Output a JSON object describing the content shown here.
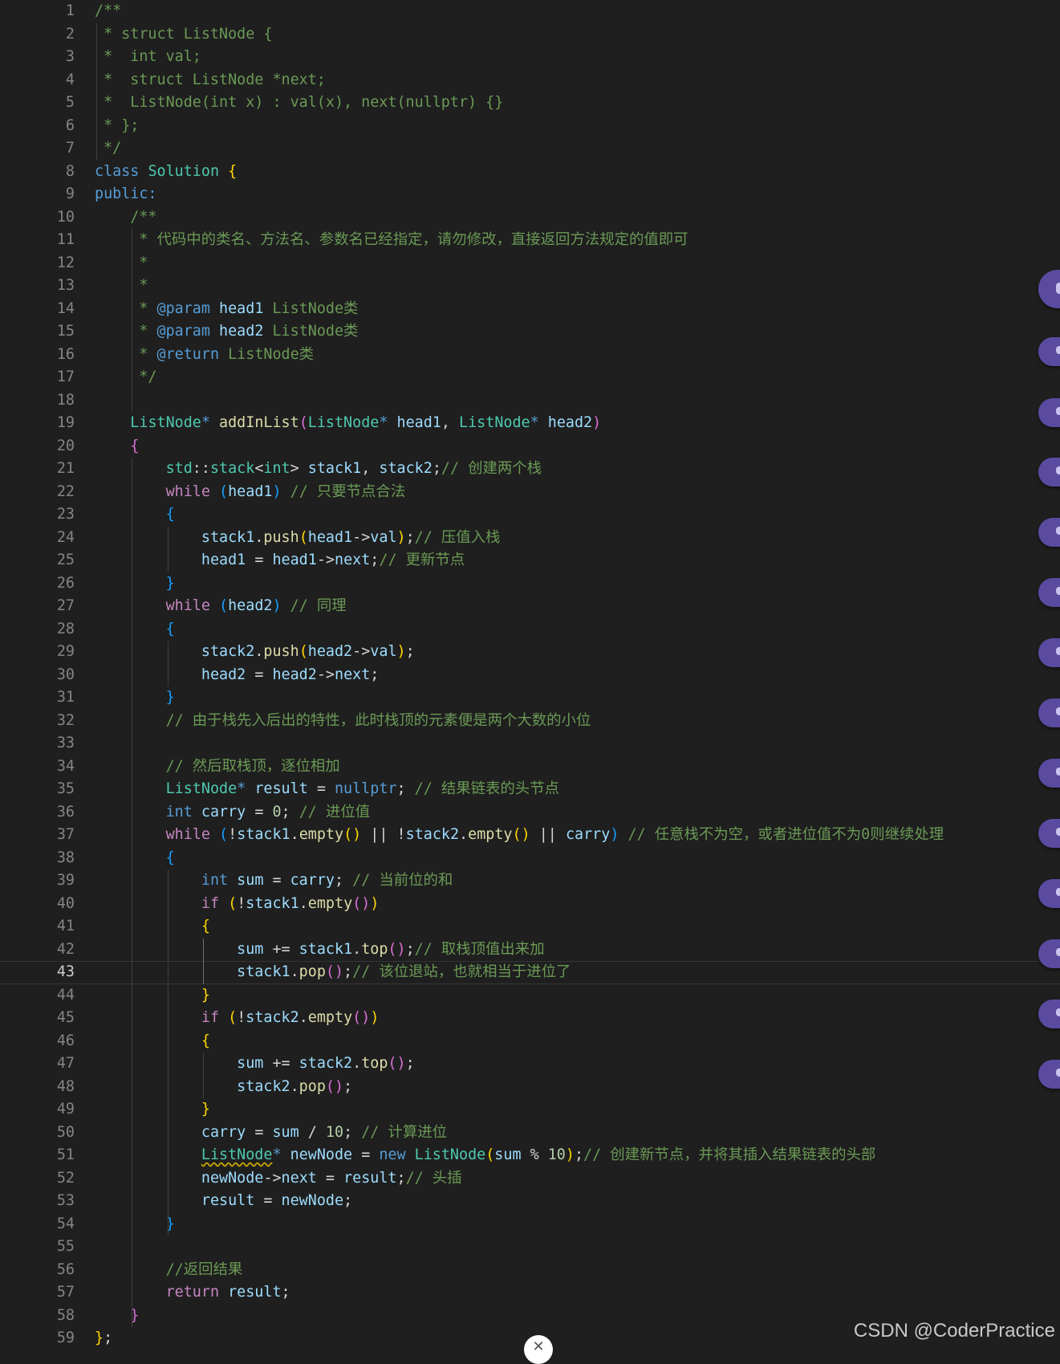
{
  "editor": {
    "current_line": 43,
    "lines": [
      [
        [
          "/**",
          "comment"
        ]
      ],
      [
        [
          " * struct ListNode {",
          "comment"
        ]
      ],
      [
        [
          " *  int val;",
          "comment"
        ]
      ],
      [
        [
          " *  struct ListNode *next;",
          "comment"
        ]
      ],
      [
        [
          " *  ListNode(int x) : val(x), next(nullptr) {}",
          "comment"
        ]
      ],
      [
        [
          " * };",
          "comment"
        ]
      ],
      [
        [
          " */",
          "comment"
        ]
      ],
      [
        [
          "class ",
          "kw"
        ],
        [
          "Solution",
          "type"
        ],
        [
          " ",
          ""
        ],
        [
          "{",
          "b1"
        ]
      ],
      [
        [
          "public:",
          "kw"
        ]
      ],
      [
        [
          "    /**",
          "comment"
        ]
      ],
      [
        [
          "     * 代码中的类名、方法名、参数名已经指定，请勿修改，直接返回方法规定的值即可",
          "comment"
        ]
      ],
      [
        [
          "     *",
          "comment"
        ]
      ],
      [
        [
          "     *",
          "comment"
        ]
      ],
      [
        [
          "     * ",
          "comment"
        ],
        [
          "@param",
          "doc"
        ],
        [
          " ",
          ""
        ],
        [
          "head1",
          "param"
        ],
        [
          " ListNode类",
          "comment"
        ]
      ],
      [
        [
          "     * ",
          "comment"
        ],
        [
          "@param",
          "doc"
        ],
        [
          " ",
          ""
        ],
        [
          "head2",
          "param"
        ],
        [
          " ListNode类",
          "comment"
        ]
      ],
      [
        [
          "     * ",
          "comment"
        ],
        [
          "@return",
          "doc"
        ],
        [
          " ListNode类",
          "comment"
        ]
      ],
      [
        [
          "     */",
          "comment"
        ]
      ],
      [],
      [
        [
          "    ",
          ""
        ],
        [
          "ListNode",
          "type"
        ],
        [
          "* ",
          "kw"
        ],
        [
          "addInList",
          "func"
        ],
        [
          "(",
          "b2"
        ],
        [
          "ListNode",
          "type"
        ],
        [
          "* ",
          "kw"
        ],
        [
          "head1",
          "var"
        ],
        [
          ", ",
          ""
        ],
        [
          "ListNode",
          "type"
        ],
        [
          "* ",
          "kw"
        ],
        [
          "head2",
          "var"
        ],
        [
          ")",
          "b2"
        ]
      ],
      [
        [
          "    ",
          ""
        ],
        [
          "{",
          "b2"
        ]
      ],
      [
        [
          "        ",
          ""
        ],
        [
          "std",
          "type"
        ],
        [
          "::",
          ""
        ],
        [
          "stack",
          "type"
        ],
        [
          "<",
          ""
        ],
        [
          "int",
          "type"
        ],
        [
          "> ",
          ""
        ],
        [
          "stack1",
          "var"
        ],
        [
          ", ",
          ""
        ],
        [
          "stack2",
          "var"
        ],
        [
          ";",
          ""
        ],
        [
          "// 创建两个栈",
          "comment"
        ]
      ],
      [
        [
          "        ",
          ""
        ],
        [
          "while",
          "ctrl"
        ],
        [
          " ",
          ""
        ],
        [
          "(",
          "b3"
        ],
        [
          "head1",
          "var"
        ],
        [
          ")",
          "b3"
        ],
        [
          " ",
          ""
        ],
        [
          "// 只要节点合法",
          "comment"
        ]
      ],
      [
        [
          "        ",
          ""
        ],
        [
          "{",
          "b3"
        ]
      ],
      [
        [
          "            ",
          ""
        ],
        [
          "stack1",
          "var"
        ],
        [
          ".",
          ""
        ],
        [
          "push",
          "func"
        ],
        [
          "(",
          "b1"
        ],
        [
          "head1",
          "var"
        ],
        [
          "->",
          ""
        ],
        [
          "val",
          "var"
        ],
        [
          ")",
          "b1"
        ],
        [
          ";",
          ""
        ],
        [
          "// 压值入栈",
          "comment"
        ]
      ],
      [
        [
          "            ",
          ""
        ],
        [
          "head1",
          "var"
        ],
        [
          " = ",
          ""
        ],
        [
          "head1",
          "var"
        ],
        [
          "->",
          ""
        ],
        [
          "next",
          "var"
        ],
        [
          ";",
          ""
        ],
        [
          "// 更新节点",
          "comment"
        ]
      ],
      [
        [
          "        ",
          ""
        ],
        [
          "}",
          "b3"
        ]
      ],
      [
        [
          "        ",
          ""
        ],
        [
          "while",
          "ctrl"
        ],
        [
          " ",
          ""
        ],
        [
          "(",
          "b3"
        ],
        [
          "head2",
          "var"
        ],
        [
          ")",
          "b3"
        ],
        [
          " ",
          ""
        ],
        [
          "// 同理",
          "comment"
        ]
      ],
      [
        [
          "        ",
          ""
        ],
        [
          "{",
          "b3"
        ]
      ],
      [
        [
          "            ",
          ""
        ],
        [
          "stack2",
          "var"
        ],
        [
          ".",
          ""
        ],
        [
          "push",
          "func"
        ],
        [
          "(",
          "b1"
        ],
        [
          "head2",
          "var"
        ],
        [
          "->",
          ""
        ],
        [
          "val",
          "var"
        ],
        [
          ")",
          "b1"
        ],
        [
          ";",
          ""
        ]
      ],
      [
        [
          "            ",
          ""
        ],
        [
          "head2",
          "var"
        ],
        [
          " = ",
          ""
        ],
        [
          "head2",
          "var"
        ],
        [
          "->",
          ""
        ],
        [
          "next",
          "var"
        ],
        [
          ";",
          ""
        ]
      ],
      [
        [
          "        ",
          ""
        ],
        [
          "}",
          "b3"
        ]
      ],
      [
        [
          "        ",
          ""
        ],
        [
          "// 由于栈先入后出的特性，此时栈顶的元素便是两个大数的小位",
          "comment"
        ]
      ],
      [],
      [
        [
          "        ",
          ""
        ],
        [
          "// 然后取栈顶，逐位相加",
          "comment"
        ]
      ],
      [
        [
          "        ",
          ""
        ],
        [
          "ListNode",
          "type"
        ],
        [
          "* ",
          "kw"
        ],
        [
          "result",
          "var"
        ],
        [
          " = ",
          ""
        ],
        [
          "nullptr",
          "kw"
        ],
        [
          "; ",
          ""
        ],
        [
          "// 结果链表的头节点",
          "comment"
        ]
      ],
      [
        [
          "        ",
          ""
        ],
        [
          "int",
          "kw"
        ],
        [
          " ",
          ""
        ],
        [
          "carry",
          "var"
        ],
        [
          " = ",
          ""
        ],
        [
          "0",
          "num"
        ],
        [
          "; ",
          ""
        ],
        [
          "// 进位值",
          "comment"
        ]
      ],
      [
        [
          "        ",
          ""
        ],
        [
          "while",
          "ctrl"
        ],
        [
          " ",
          ""
        ],
        [
          "(",
          "b3"
        ],
        [
          "!",
          ""
        ],
        [
          "stack1",
          "var"
        ],
        [
          ".",
          ""
        ],
        [
          "empty",
          "func"
        ],
        [
          "()",
          "b1"
        ],
        [
          " || !",
          ""
        ],
        [
          "stack2",
          "var"
        ],
        [
          ".",
          ""
        ],
        [
          "empty",
          "func"
        ],
        [
          "()",
          "b1"
        ],
        [
          " || ",
          ""
        ],
        [
          "carry",
          "var"
        ],
        [
          ")",
          "b3"
        ],
        [
          " ",
          ""
        ],
        [
          "// 任意栈不为空，或者进位值不为0则继续处理",
          "comment"
        ]
      ],
      [
        [
          "        ",
          ""
        ],
        [
          "{",
          "b3"
        ]
      ],
      [
        [
          "            ",
          ""
        ],
        [
          "int",
          "kw"
        ],
        [
          " ",
          ""
        ],
        [
          "sum",
          "var"
        ],
        [
          " = ",
          ""
        ],
        [
          "carry",
          "var"
        ],
        [
          "; ",
          ""
        ],
        [
          "// 当前位的和",
          "comment"
        ]
      ],
      [
        [
          "            ",
          ""
        ],
        [
          "if",
          "ctrl"
        ],
        [
          " ",
          ""
        ],
        [
          "(",
          "b1"
        ],
        [
          "!",
          ""
        ],
        [
          "stack1",
          "var"
        ],
        [
          ".",
          ""
        ],
        [
          "empty",
          "func"
        ],
        [
          "()",
          "b2"
        ],
        [
          ")",
          "b1"
        ]
      ],
      [
        [
          "            ",
          ""
        ],
        [
          "{",
          "b1"
        ]
      ],
      [
        [
          "                ",
          ""
        ],
        [
          "sum",
          "var"
        ],
        [
          " += ",
          ""
        ],
        [
          "stack1",
          "var"
        ],
        [
          ".",
          ""
        ],
        [
          "top",
          "func"
        ],
        [
          "()",
          "b2"
        ],
        [
          ";",
          ""
        ],
        [
          "// 取栈顶值出来加",
          "comment"
        ]
      ],
      [
        [
          "                ",
          ""
        ],
        [
          "stack1",
          "var"
        ],
        [
          ".",
          ""
        ],
        [
          "pop",
          "func"
        ],
        [
          "()",
          "b2"
        ],
        [
          ";",
          ""
        ],
        [
          "// 该位退站，也就相当于进位了",
          "comment"
        ]
      ],
      [
        [
          "            ",
          ""
        ],
        [
          "}",
          "b1"
        ]
      ],
      [
        [
          "            ",
          ""
        ],
        [
          "if",
          "ctrl"
        ],
        [
          " ",
          ""
        ],
        [
          "(",
          "b1"
        ],
        [
          "!",
          ""
        ],
        [
          "stack2",
          "var"
        ],
        [
          ".",
          ""
        ],
        [
          "empty",
          "func"
        ],
        [
          "()",
          "b2"
        ],
        [
          ")",
          "b1"
        ]
      ],
      [
        [
          "            ",
          ""
        ],
        [
          "{",
          "b1"
        ]
      ],
      [
        [
          "                ",
          ""
        ],
        [
          "sum",
          "var"
        ],
        [
          " += ",
          ""
        ],
        [
          "stack2",
          "var"
        ],
        [
          ".",
          ""
        ],
        [
          "top",
          "func"
        ],
        [
          "()",
          "b2"
        ],
        [
          ";",
          ""
        ]
      ],
      [
        [
          "                ",
          ""
        ],
        [
          "stack2",
          "var"
        ],
        [
          ".",
          ""
        ],
        [
          "pop",
          "func"
        ],
        [
          "()",
          "b2"
        ],
        [
          ";",
          ""
        ]
      ],
      [
        [
          "            ",
          ""
        ],
        [
          "}",
          "b1"
        ]
      ],
      [
        [
          "            ",
          ""
        ],
        [
          "carry",
          "var"
        ],
        [
          " = ",
          ""
        ],
        [
          "sum",
          "var"
        ],
        [
          " / ",
          ""
        ],
        [
          "10",
          "num"
        ],
        [
          "; ",
          ""
        ],
        [
          "// 计算进位",
          "comment"
        ]
      ],
      [
        [
          "            ",
          ""
        ],
        [
          "ListNode",
          "type-squiggle"
        ],
        [
          "* ",
          "kw"
        ],
        [
          "newNode",
          "var"
        ],
        [
          " = ",
          ""
        ],
        [
          "new",
          "kw"
        ],
        [
          " ",
          ""
        ],
        [
          "ListNode",
          "type"
        ],
        [
          "(",
          "b1"
        ],
        [
          "sum",
          "var"
        ],
        [
          " % ",
          ""
        ],
        [
          "10",
          "num"
        ],
        [
          ")",
          "b1"
        ],
        [
          ";",
          ""
        ],
        [
          "// 创建新节点，并将其插入结果链表的头部",
          "comment"
        ]
      ],
      [
        [
          "            ",
          ""
        ],
        [
          "newNode",
          "var"
        ],
        [
          "->",
          ""
        ],
        [
          "next",
          "var"
        ],
        [
          " = ",
          ""
        ],
        [
          "result",
          "var"
        ],
        [
          ";",
          ""
        ],
        [
          "// 头插",
          "comment"
        ]
      ],
      [
        [
          "            ",
          ""
        ],
        [
          "result",
          "var"
        ],
        [
          " = ",
          ""
        ],
        [
          "newNode",
          "var"
        ],
        [
          ";",
          ""
        ]
      ],
      [
        [
          "        ",
          ""
        ],
        [
          "}",
          "b3"
        ]
      ],
      [],
      [
        [
          "        ",
          ""
        ],
        [
          "//返回结果",
          "comment"
        ]
      ],
      [
        [
          "        ",
          ""
        ],
        [
          "return",
          "ctrl"
        ],
        [
          " ",
          ""
        ],
        [
          "result",
          "var"
        ],
        [
          ";",
          ""
        ]
      ],
      [
        [
          "    ",
          ""
        ],
        [
          "}",
          "b2"
        ]
      ],
      [
        [
          "}",
          "b1"
        ],
        [
          ";",
          ""
        ]
      ]
    ]
  },
  "icons": {
    "side_button": "chat-bubble-icon",
    "close": "close-icon"
  },
  "close_glyph": "✕",
  "watermark": "CSDN @CoderPractice"
}
